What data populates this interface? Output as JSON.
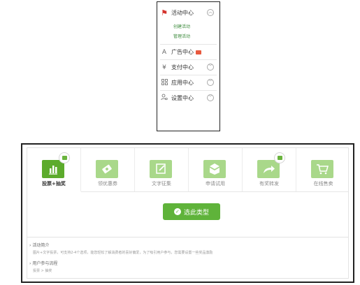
{
  "sidebar": {
    "activity_center": {
      "label": "活动中心",
      "icon": "flag-icon"
    },
    "sub_items": [
      "创建活动",
      "管理活动"
    ],
    "ad_center": {
      "label": "广告中心",
      "icon": "triangle-icon",
      "badge": "new-badge"
    },
    "payment_center": {
      "label": "支付中心",
      "icon": "yen-icon"
    },
    "app_center": {
      "label": "应用中心",
      "icon": "grid-icon"
    },
    "settings_center": {
      "label": "设置中心",
      "icon": "user-settings-icon"
    }
  },
  "activity_types": {
    "tabs": [
      {
        "label": "投票+抽奖",
        "icon": "bar-chart-icon",
        "active": true,
        "gift": true
      },
      {
        "label": "领优惠券",
        "icon": "coupon-icon",
        "active": false,
        "gift": false
      },
      {
        "label": "文字征集",
        "icon": "edit-icon",
        "active": false,
        "gift": false
      },
      {
        "label": "申请试用",
        "icon": "box-icon",
        "active": false,
        "gift": false
      },
      {
        "label": "有奖转发",
        "icon": "share-icon",
        "active": false,
        "gift": true
      },
      {
        "label": "在线售卖",
        "icon": "cart-icon",
        "active": false,
        "gift": false
      }
    ],
    "select_button": "选此类型",
    "intro_title": "活动简介",
    "intro_text": "图片+文字投票，可支持2-4个选项，能您轻松了解消费者的喜好偏爱，为了吸引用户参与，您需要设置一些奖品激励",
    "flow_title": "用户参与流程",
    "flow_text": "投票 > 抽奖"
  },
  "colors": {
    "accent_green": "#5fb33a",
    "light_green": "#a9d88a",
    "flag_red": "#d4322c"
  }
}
